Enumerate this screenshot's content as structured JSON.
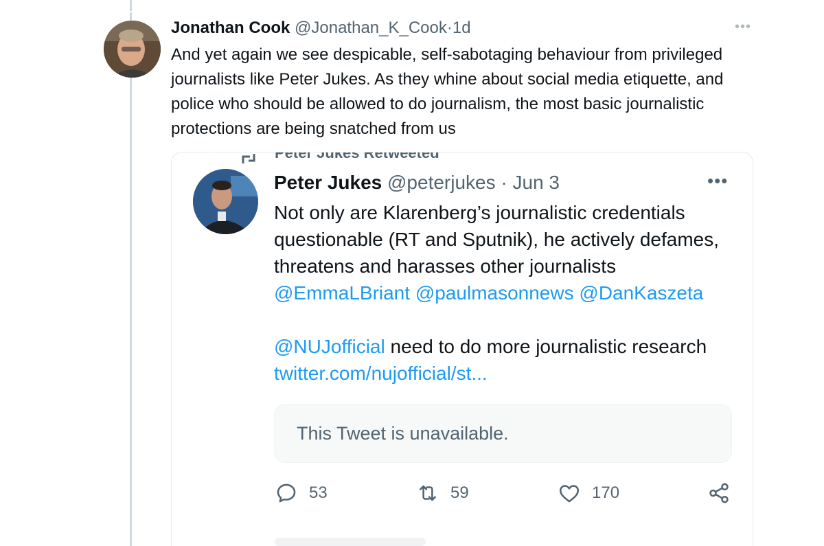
{
  "tweet": {
    "author_name": "Jonathan Cook",
    "author_handle": "@Jonathan_K_Cook",
    "separator": "·",
    "time": "1d",
    "text": "And yet again we see despicable, self-sabotaging behaviour from privileged journalists like Peter Jukes. As they whine about social media etiquette, and police who should be allowed to do journalism, the most basic journalistic protections are being snatched from us"
  },
  "quote": {
    "retweeted_by": "Peter Jukes Retweeted",
    "author_name": "Peter Jukes",
    "author_handle": "@peterjukes",
    "separator": "·",
    "date": "Jun 3",
    "text_1": "Not only are Klarenberg’s journalistic credentials questionable (RT and Sputnik), he actively defames, threatens and harasses other journalists",
    "mentions_1": [
      "@EmmaLBriant",
      "@paulmasonnews",
      "@DanKaszeta"
    ],
    "mention_2": "@NUJofficial",
    "text_2": " need to do more journalistic research",
    "link": "twitter.com/nujofficial/st...",
    "unavailable_text": "This Tweet is unavailable.",
    "actions": {
      "replies": "53",
      "retweets": "59",
      "likes": "170"
    }
  },
  "colors": {
    "link": "#1d9bf0",
    "secondary_text": "#536471",
    "primary_text": "#0f1419"
  }
}
